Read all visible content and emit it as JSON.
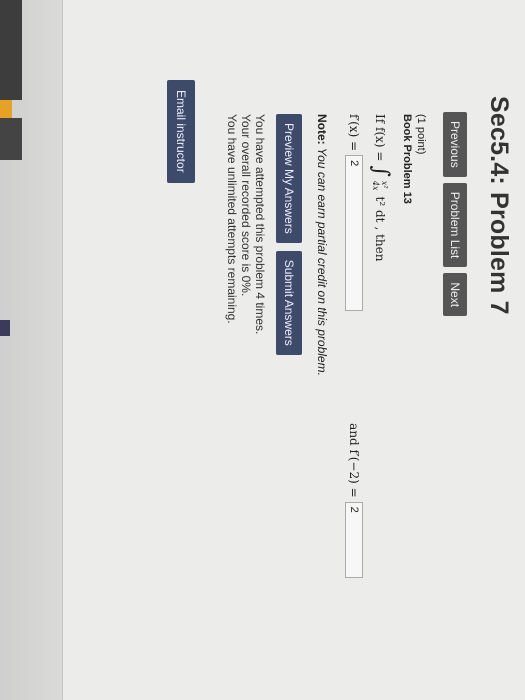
{
  "problem": {
    "title": "Sec5.4: Problem 7",
    "points": "(1 point)",
    "book_problem": "Book Problem 13",
    "statement_prefix": "If f(x) =",
    "integral_upper": "x²",
    "integral_lower": "4x",
    "integrand": "t² dt",
    "statement_suffix": ", then",
    "answer1_label": "f′(x) =",
    "answer1_value": "2",
    "answer2_label": "and f′(−2) =",
    "answer2_value": "2"
  },
  "nav": {
    "previous": "Previous",
    "problem_list": "Problem List",
    "next": "Next"
  },
  "note": {
    "label": "Note:",
    "text": " You can earn partial credit on this problem."
  },
  "actions": {
    "preview": "Preview My Answers",
    "submit": "Submit Answers"
  },
  "status": {
    "attempts": "You have attempted this problem 4 times.",
    "score": "Your overall recorded score is 0%.",
    "remaining": "You have unlimited attempts remaining."
  },
  "footer": {
    "email_instructor": "Email instructor"
  }
}
